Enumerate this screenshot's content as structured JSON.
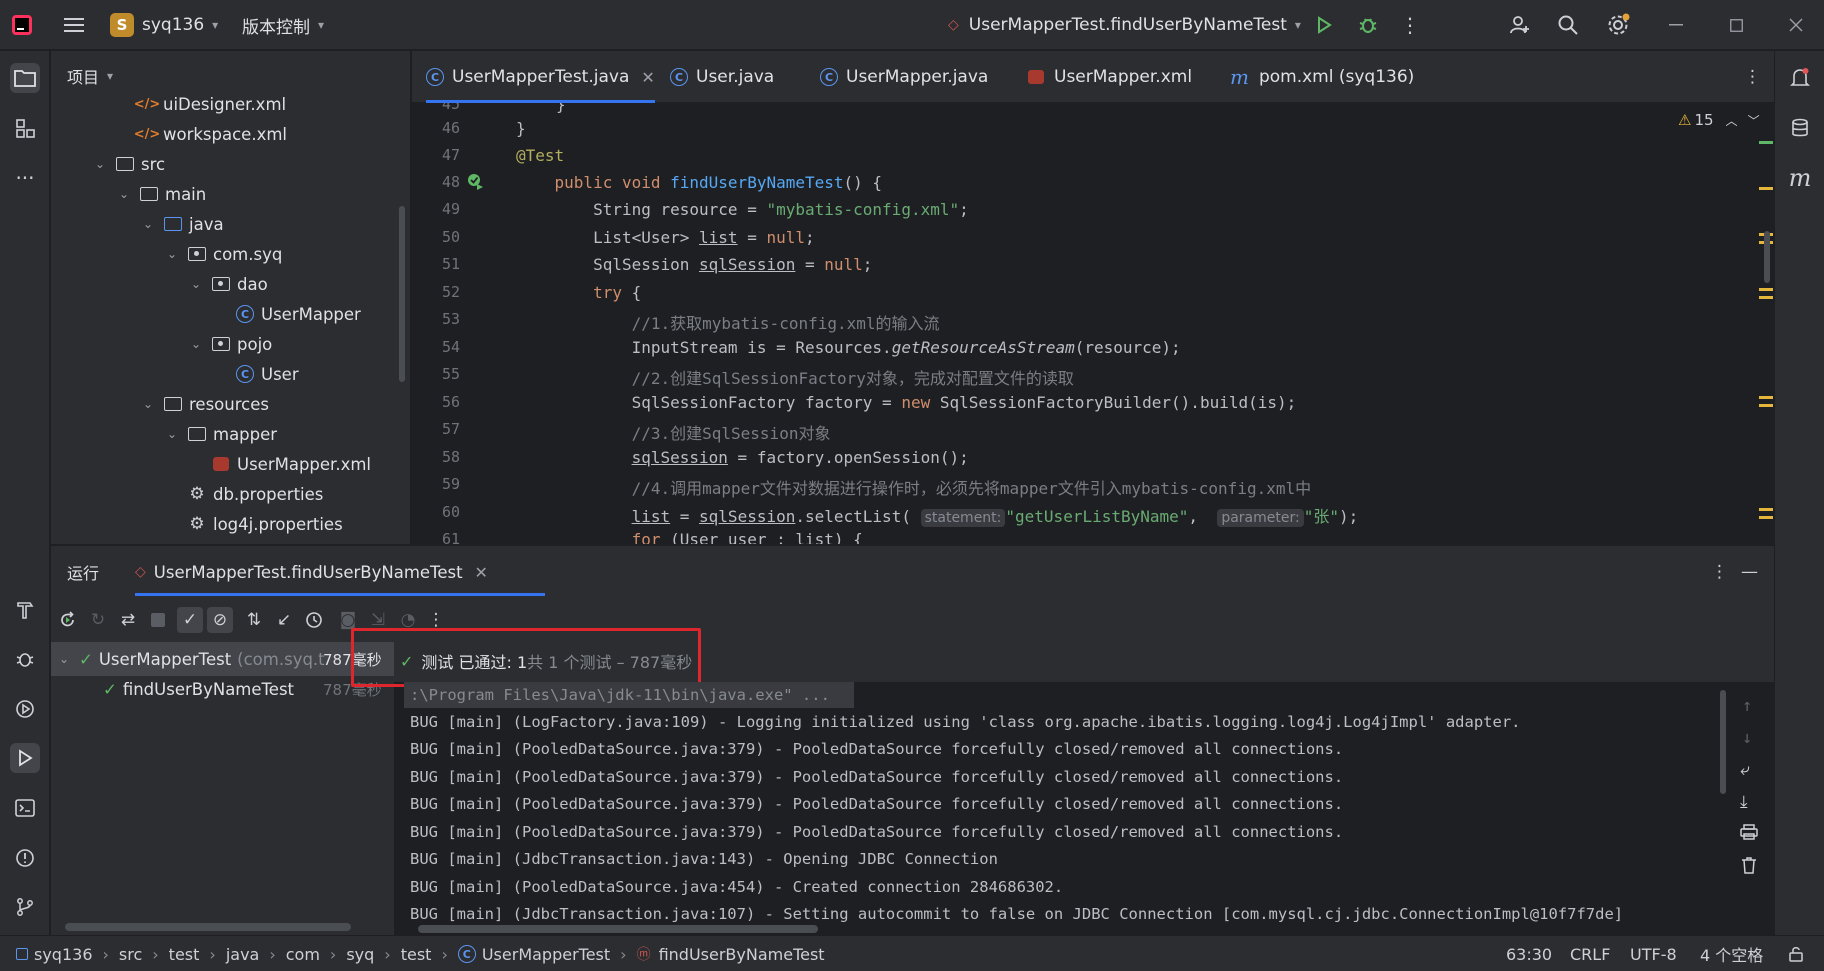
{
  "titlebar": {
    "project_badge": "S",
    "project_name": "syq136",
    "vcs_label": "版本控制",
    "run_config": "UserMapperTest.findUserByNameTest"
  },
  "project_panel": {
    "title": "项目",
    "items": [
      {
        "label": "uiDesigner.xml",
        "type": "xml"
      },
      {
        "label": "workspace.xml",
        "type": "xml"
      },
      {
        "label": "src",
        "type": "folder"
      },
      {
        "label": "main",
        "type": "folder"
      },
      {
        "label": "java",
        "type": "folder-blue"
      },
      {
        "label": "com.syq",
        "type": "package"
      },
      {
        "label": "dao",
        "type": "package"
      },
      {
        "label": "UserMapper",
        "type": "class"
      },
      {
        "label": "pojo",
        "type": "package"
      },
      {
        "label": "User",
        "type": "class"
      },
      {
        "label": "resources",
        "type": "folder"
      },
      {
        "label": "mapper",
        "type": "folder"
      },
      {
        "label": "UserMapper.xml",
        "type": "mybatis"
      },
      {
        "label": "db.properties",
        "type": "properties"
      },
      {
        "label": "log4j.properties",
        "type": "properties"
      }
    ]
  },
  "tabs": [
    {
      "label": "UserMapperTest.java",
      "icon": "class-icon",
      "active": true
    },
    {
      "label": "User.java",
      "icon": "class-icon"
    },
    {
      "label": "UserMapper.java",
      "icon": "interface-icon"
    },
    {
      "label": "UserMapper.xml",
      "icon": "mybatis-icon"
    },
    {
      "label": "pom.xml (syq136)",
      "icon": "maven-icon"
    }
  ],
  "editor": {
    "warnings": "15",
    "line_numbers": [
      "46",
      "47",
      "48",
      "49",
      "50",
      "51",
      "52",
      "53",
      "54",
      "55",
      "56",
      "57",
      "58",
      "59",
      "60",
      "61"
    ],
    "hint_statement": "statement:",
    "hint_parameter": "parameter:"
  },
  "run_panel": {
    "title": "运行",
    "tab_label": "UserMapperTest.findUserByNameTest",
    "tree": [
      {
        "label": "UserMapperTest",
        "detail": "(com.syq.t",
        "time": "787毫秒"
      },
      {
        "label": "findUserByNameTest",
        "detail": "",
        "time": "787毫秒"
      }
    ],
    "status": {
      "passed": "测试 已通过: 1",
      "summary": "共 1 个测试 – 787毫秒"
    },
    "console": [
      ":\\Program Files\\Java\\jdk-11\\bin\\java.exe\" ...",
      "BUG [main] (LogFactory.java:109) - Logging initialized using 'class org.apache.ibatis.logging.log4j.Log4jImpl' adapter.",
      "BUG [main] (PooledDataSource.java:379) - PooledDataSource forcefully closed/removed all connections.",
      "BUG [main] (PooledDataSource.java:379) - PooledDataSource forcefully closed/removed all connections.",
      "BUG [main] (PooledDataSource.java:379) - PooledDataSource forcefully closed/removed all connections.",
      "BUG [main] (PooledDataSource.java:379) - PooledDataSource forcefully closed/removed all connections.",
      "BUG [main] (JdbcTransaction.java:143) - Opening JDBC Connection",
      "BUG [main] (PooledDataSource.java:454) - Created connection 284686302.",
      "BUG [main] (JdbcTransaction.java:107) - Setting autocommit to false on JDBC Connection [com.mysql.cj.jdbc.ConnectionImpl@10f7f7de]"
    ]
  },
  "statusbar": {
    "breadcrumbs": [
      "syq136",
      "src",
      "test",
      "java",
      "com",
      "syq",
      "test",
      "UserMapperTest",
      "findUserByNameTest"
    ],
    "position": "63:30",
    "line_ending": "CRLF",
    "encoding": "UTF-8",
    "indent": "4 个空格"
  },
  "colors": {
    "accent": "#3574f0",
    "highlight_box": "#e0262d",
    "pass_green": "#5fb865"
  }
}
